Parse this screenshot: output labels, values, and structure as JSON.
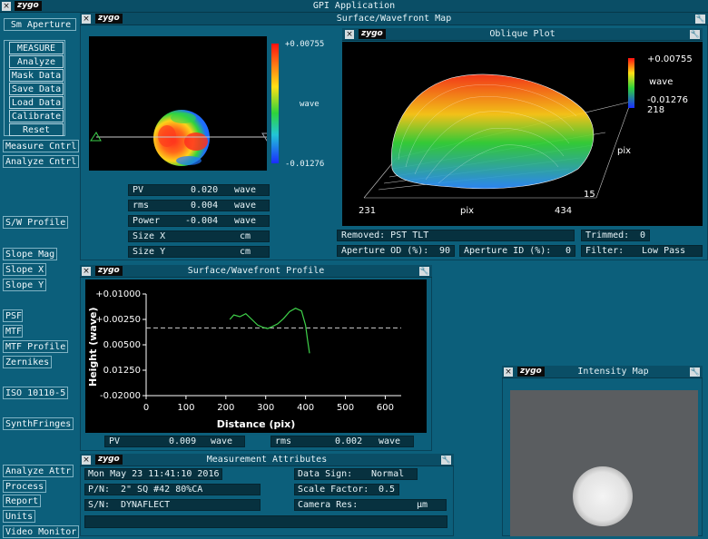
{
  "app": {
    "logo": "zygo",
    "title": "GPI Application"
  },
  "sidebar": {
    "aperture_label": "Sm Aperture",
    "main_buttons": [
      "MEASURE",
      "Analyze",
      "Mask Data",
      "Save Data",
      "Load Data",
      "Calibrate",
      "Reset"
    ],
    "measure_cntrl": "Measure Cntrl",
    "analyze_cntrl": "Analyze Cntrl",
    "sw_profile": "S/W Profile",
    "slope_mag": "Slope Mag",
    "slope_x": "Slope X",
    "slope_y": "Slope Y",
    "psf": "PSF",
    "mtf": "MTF",
    "mtf_profile": "MTF Profile",
    "zernikes": "Zernikes",
    "iso": "ISO 10110-5",
    "synth": "SynthFringes",
    "analyze_attr": "Analyze Attr",
    "process": "Process",
    "report": "Report",
    "units": "Units",
    "video_monitor": "Video Monitor"
  },
  "surface_map": {
    "title": "Surface/Wavefront Map",
    "logo": "zygo",
    "scale_max": "+0.00755",
    "scale_unit": "wave",
    "scale_min": "-0.01276",
    "stats": [
      {
        "label": "PV",
        "value": "0.020",
        "unit": "wave"
      },
      {
        "label": "rms",
        "value": "0.004",
        "unit": "wave"
      },
      {
        "label": "Power",
        "value": "-0.004",
        "unit": "wave"
      },
      {
        "label": "Size X",
        "value": "",
        "unit": "cm"
      },
      {
        "label": "Size Y",
        "value": "",
        "unit": "cm"
      }
    ]
  },
  "oblique": {
    "title": "Oblique Plot",
    "logo": "zygo",
    "scale_max": "+0.00755",
    "scale_unit": "wave",
    "scale_min": "-0.01276",
    "y_top": "218",
    "y_axis": "pix",
    "y_bottom": "15",
    "x_left": "231",
    "x_axis": "pix",
    "x_right": "434"
  },
  "status": {
    "removed": "Removed: PST TLT",
    "trimmed_label": "Trimmed:",
    "trimmed_value": "0",
    "aperture_od_label": "Aperture OD (%):",
    "aperture_od_value": "90",
    "aperture_id_label": "Aperture ID (%):",
    "aperture_id_value": "0",
    "filter_label": "Filter:",
    "filter_value": "Low Pass"
  },
  "profile": {
    "title": "Surface/Wavefront Profile",
    "logo": "zygo",
    "pv_label": "PV",
    "pv_value": "0.009",
    "pv_unit": "wave",
    "rms_label": "rms",
    "rms_value": "0.002",
    "rms_unit": "wave"
  },
  "chart_data": {
    "type": "line",
    "title": "",
    "xlabel": "Distance (pix)",
    "ylabel": "Height (wave)",
    "xlim": [
      0,
      640
    ],
    "ylim": [
      -0.02,
      0.01
    ],
    "x_ticks": [
      "0",
      "100",
      "200",
      "300",
      "400",
      "500",
      "600"
    ],
    "y_ticks": [
      "+0.01000",
      "+0.00250",
      "0.00500",
      "0.01250",
      "-0.02000"
    ],
    "grid": false,
    "reference_line_y": 0,
    "series": [
      {
        "x": [
          210,
          220,
          235,
          250,
          265,
          280,
          295,
          305,
          315,
          330,
          345,
          360,
          375,
          390,
          400,
          405,
          410
        ],
        "y": [
          0.0025,
          0.0038,
          0.0033,
          0.0042,
          0.0025,
          0.0008,
          0.0001,
          -0.0002,
          0.0003,
          0.0012,
          0.0028,
          0.0048,
          0.0058,
          0.005,
          0.0008,
          -0.0035,
          -0.0075
        ]
      }
    ]
  },
  "intensity": {
    "title": "Intensity Map",
    "logo": "zygo"
  },
  "attributes": {
    "title": "Measurement Attributes",
    "logo": "zygo",
    "date": "Mon May 23 11:41:10 2016",
    "pn_label": "P/N:",
    "pn_value": "2\" SQ #42 80%CA",
    "sn_label": "S/N:",
    "sn_value": "DYNAFLECT",
    "data_sign_label": "Data Sign:",
    "data_sign_value": "Normal",
    "scale_factor_label": "Scale Factor:",
    "scale_factor_value": "0.5",
    "camera_res_label": "Camera Res:",
    "camera_res_value": "",
    "camera_res_unit": "µm"
  },
  "colors": {
    "background": "#0c5f7b",
    "titlebar": "#0a4e66",
    "field": "#07313f"
  }
}
